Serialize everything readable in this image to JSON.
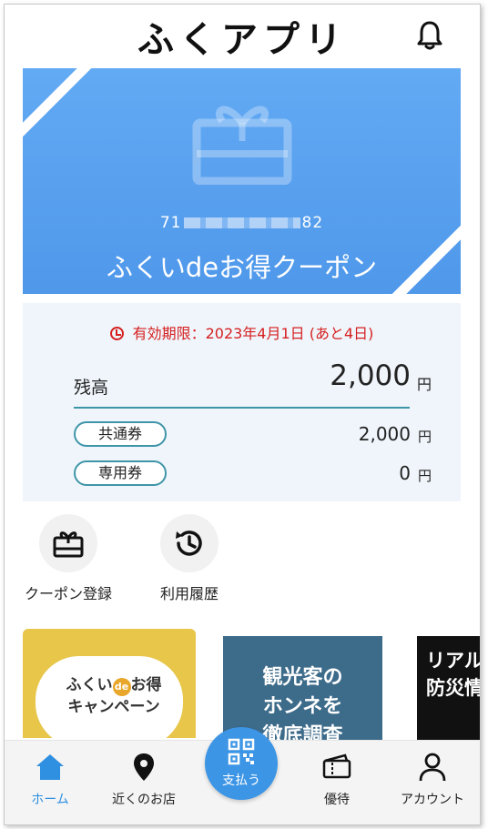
{
  "app": {
    "title": "ふくアプリ"
  },
  "coupon": {
    "number_prefix": "71",
    "number_suffix": "82",
    "title": "ふくいdeお得クーポン",
    "expiry": "有効期限：2023年4月1日 (あと4日)"
  },
  "balance": {
    "label": "残高",
    "amount": "2,000",
    "unit": "円",
    "items": [
      {
        "label": "共通券",
        "amount": "2,000",
        "unit": "円"
      },
      {
        "label": "専用券",
        "amount": "0",
        "unit": "円"
      }
    ]
  },
  "actions": [
    {
      "label": "クーポン登録",
      "icon": "gift-icon"
    },
    {
      "label": "利用履歴",
      "icon": "history-icon"
    }
  ],
  "banners": [
    {
      "text_line1": "ふくい",
      "badge": "de",
      "text_line1b": "お得",
      "text_line2": "キャンペーン"
    },
    {
      "text_line1": "観光客の",
      "text_line2": "ホンネを",
      "text_line3": "徹底調査"
    },
    {
      "text_line1": "リアル",
      "text_line2": "防災情"
    }
  ],
  "nav": {
    "items": [
      {
        "label": "ホーム",
        "icon": "home-icon",
        "active": true
      },
      {
        "label": "近くのお店",
        "icon": "map-pin-icon"
      },
      {
        "label": "支払う",
        "icon": "qr-code-icon"
      },
      {
        "label": "優待",
        "icon": "ticket-icon"
      },
      {
        "label": "アカウント",
        "icon": "user-icon"
      }
    ]
  },
  "colors": {
    "accent": "#3d95e6",
    "card": "#5aa3f0",
    "warning": "#d62020",
    "teal": "#3f95a8"
  }
}
